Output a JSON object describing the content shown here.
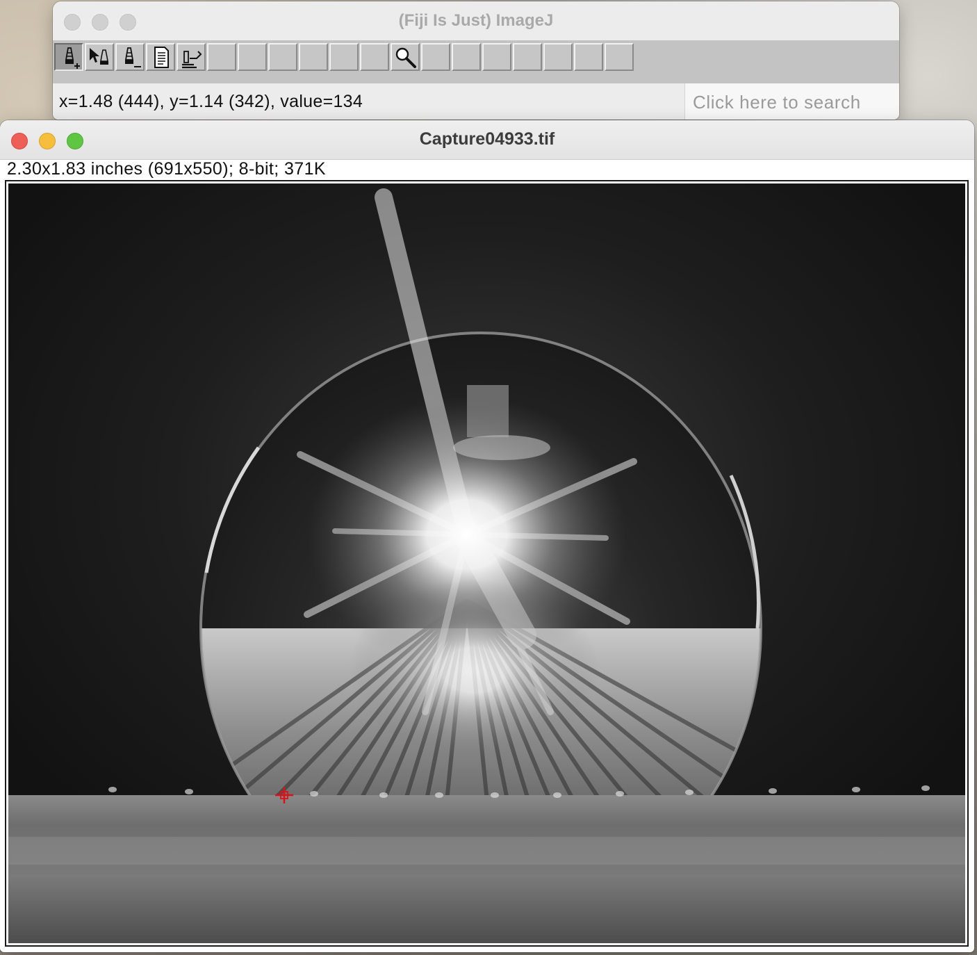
{
  "imagej_window": {
    "title": "(Fiji Is Just) ImageJ",
    "status_text": "x=1.48 (444), y=1.14 (342), value=134",
    "search_placeholder": "Click here to search",
    "tools": [
      {
        "name": "tool-pencil-add",
        "icon": "pencil-plus-icon",
        "selected": true
      },
      {
        "name": "tool-pencil-arrow",
        "icon": "arrow-pencil-icon",
        "selected": false
      },
      {
        "name": "tool-pencil-minus",
        "icon": "pencil-minus-icon",
        "selected": false
      },
      {
        "name": "tool-document",
        "icon": "document-icon",
        "selected": false
      },
      {
        "name": "tool-microscope",
        "icon": "microscope-icon",
        "selected": false
      },
      {
        "name": "tool-empty-1",
        "icon": "",
        "selected": false
      },
      {
        "name": "tool-empty-2",
        "icon": "",
        "selected": false
      },
      {
        "name": "tool-empty-3",
        "icon": "",
        "selected": false
      },
      {
        "name": "tool-empty-4",
        "icon": "",
        "selected": false
      },
      {
        "name": "tool-empty-5",
        "icon": "",
        "selected": false
      },
      {
        "name": "tool-empty-6",
        "icon": "",
        "selected": false
      },
      {
        "name": "tool-magnifier",
        "icon": "magnifier-icon",
        "selected": false
      },
      {
        "name": "tool-empty-7",
        "icon": "",
        "selected": false
      },
      {
        "name": "tool-empty-8",
        "icon": "",
        "selected": false
      },
      {
        "name": "tool-empty-9",
        "icon": "",
        "selected": false
      },
      {
        "name": "tool-empty-10",
        "icon": "",
        "selected": false
      },
      {
        "name": "tool-empty-11",
        "icon": "",
        "selected": false
      },
      {
        "name": "tool-empty-12",
        "icon": "",
        "selected": false
      },
      {
        "name": "tool-empty-13",
        "icon": "",
        "selected": false
      }
    ]
  },
  "image_window": {
    "title": "Capture04933.tif",
    "info": "2.30x1.83 inches (691x550); 8-bit; 371K",
    "cursor_icon": "crosshair-cursor-icon"
  },
  "colors": {
    "close": "#ee5f57",
    "minimize": "#f6be3b",
    "zoom": "#5fc644",
    "cursor": "#d9121a"
  }
}
